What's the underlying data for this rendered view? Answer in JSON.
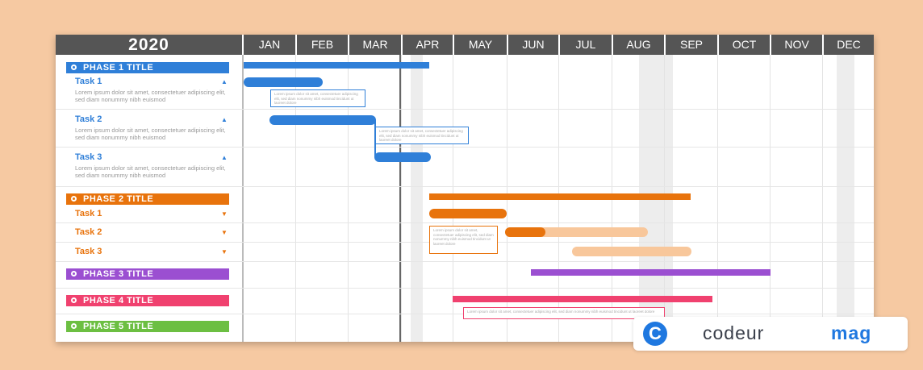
{
  "year": "2020",
  "months": [
    "JAN",
    "FEB",
    "MAR",
    "APR",
    "MAY",
    "JUN",
    "JUL",
    "AUG",
    "SEP",
    "OCT",
    "NOV",
    "DEC"
  ],
  "colors": {
    "blue": "#2f7fd8",
    "orange": "#e8730c",
    "orange_light": "#f8c79b",
    "purple": "#9b4fd1",
    "pink": "#f0416f",
    "green": "#6cbf42",
    "header_bg": "#555555"
  },
  "phases": [
    {
      "title": "PHASE 1 TITLE",
      "color": "#2f7fd8",
      "tasks": [
        {
          "name": "Task 1",
          "caret": "▲",
          "desc": "Lorem ipsum dolor sit amet, consectetuer adipiscing elit, sed diam nonummy nibh euismod"
        },
        {
          "name": "Task 2",
          "caret": "▲",
          "desc": "Lorem ipsum dolor sit amet, consectetuer adipiscing elit, sed diam nonummy nibh euismod"
        },
        {
          "name": "Task 3",
          "caret": "▲",
          "desc": "Lorem ipsum dolor sit amet, consectetuer adipiscing elit, sed diam nonummy nibh euismod"
        }
      ]
    },
    {
      "title": "PHASE 2 TITLE",
      "color": "#e8730c",
      "tasks": [
        {
          "name": "Task 1",
          "caret": "▼"
        },
        {
          "name": "Task 2",
          "caret": "▼"
        },
        {
          "name": "Task 3",
          "caret": "▼"
        }
      ]
    },
    {
      "title": "PHASE 3 TITLE",
      "color": "#9b4fd1",
      "tasks": []
    },
    {
      "title": "PHASE 4 TITLE",
      "color": "#f0416f",
      "tasks": []
    },
    {
      "title": "PHASE 5 TITLE",
      "color": "#6cbf42",
      "tasks": []
    }
  ],
  "notes": {
    "n1": "Lorem ipsum dolor sit amet, consectetuer adipiscing elit, sed diam nonummy nibh euismod tincidunt ut laoreet dolore",
    "n2": "Lorem ipsum dolor sit amet, consectetuer adipiscing elit, sed diam nonummy nibh euismod tincidunt ut laoreet dolore",
    "n3": "Lorem ipsum dolor sit amet, consectetuer adipiscing elit, sed diam nonummy nibh euismod tincidunt ut laoreet dolore",
    "n4": "Lorem ipsum dolor sit amet, consectetuer adipiscing elit, sed diam nonummy nibh euismod tincidunt ut laoreet dolore"
  },
  "brand": {
    "logo": "C",
    "word1": "codeur",
    "word2": "mag"
  }
}
